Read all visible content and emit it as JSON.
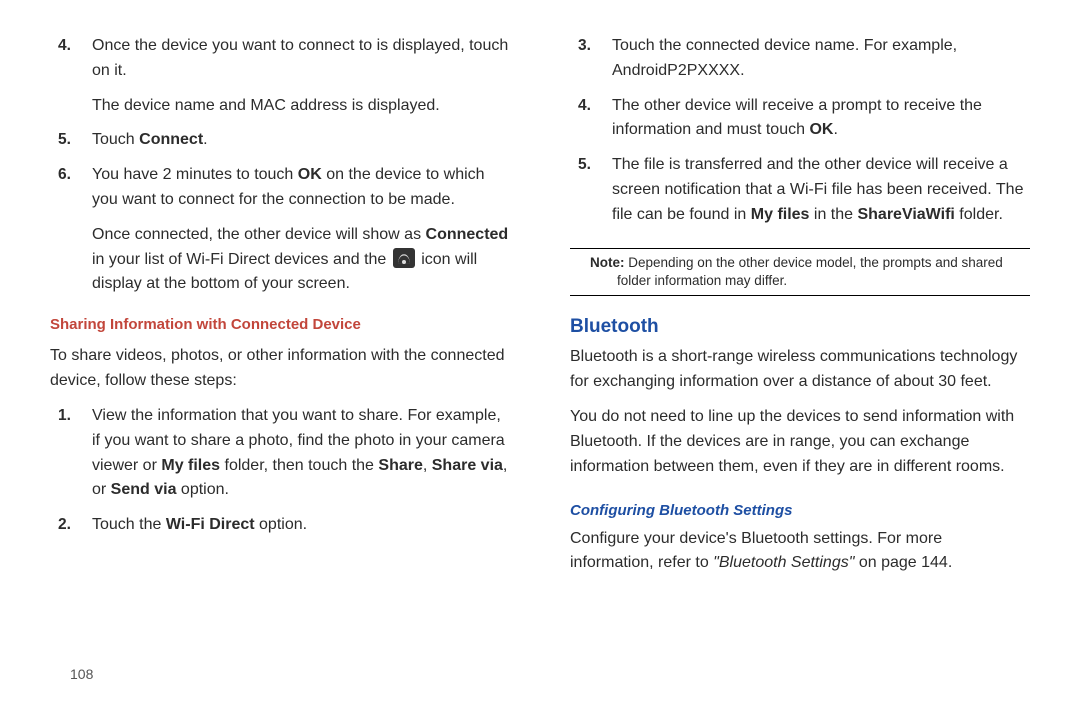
{
  "left": {
    "steps_a": [
      {
        "n": "4.",
        "text": "Once the device you want to connect to is displayed, touch on it."
      },
      {
        "n": "",
        "sub": "The device name and MAC address is displayed."
      },
      {
        "n": "5.",
        "html": "Touch <b>Connect</b>."
      },
      {
        "n": "6.",
        "html": "You have 2 minutes to touch <b>OK</b> on the device to which you want to connect for the connection to be made."
      },
      {
        "n": "",
        "html_sub_icon": {
          "pre": "Once connected, the other device will show as <b>Connected</b> in your list of Wi-Fi Direct devices and the ",
          "post": " icon will display at the bottom of your screen."
        }
      }
    ],
    "subheading": "Sharing Information with Connected Device",
    "intro": "To share videos, photos, or other information with the connected device, follow these steps:",
    "steps_b": [
      {
        "n": "1.",
        "html": "View the information that you want to share. For example, if you want to share a photo, find the photo in your camera viewer or <b>My files</b> folder, then touch the <b>Share</b>, <b>Share via</b>, or <b>Send via</b> option."
      },
      {
        "n": "2.",
        "html": "Touch the <b>Wi-Fi Direct</b> option."
      }
    ]
  },
  "right": {
    "steps": [
      {
        "n": "3.",
        "text": "Touch the connected device name. For example, AndroidP2PXXXX."
      },
      {
        "n": "4.",
        "html": "The other device will receive a prompt to receive the information and must touch <b>OK</b>."
      },
      {
        "n": "5.",
        "html": "The file is transferred and the other device will receive a screen notification that a Wi-Fi file has been received. The file can be found in <b>My files</b> in the <b>ShareViaWifi</b> folder."
      }
    ],
    "note_label": "Note:",
    "note_text": " Depending on the other device model, the prompts and shared folder information may differ.",
    "heading": "Bluetooth",
    "bt_para1": "Bluetooth is a short-range wireless communications technology for exchanging information over a distance of about 30 feet.",
    "bt_para2": "You do not need to line up the devices to send information with Bluetooth. If the devices are in range, you can exchange information between them, even if they are in different rooms.",
    "subheading": "Configuring Bluetooth Settings",
    "config_html": "Configure your device's Bluetooth settings. For more information, refer to <i>\"Bluetooth Settings\"</i>  on page 144."
  },
  "page_number": "108"
}
